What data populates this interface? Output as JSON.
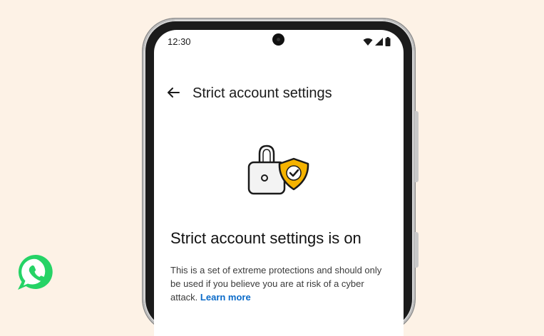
{
  "colors": {
    "background": "#fdf2e6",
    "link": "#0b6bc9",
    "shield": "#f5b300",
    "whatsapp": "#25d366"
  },
  "status_bar": {
    "time": "12:30",
    "icons": [
      "wifi-icon",
      "signal-icon",
      "battery-icon"
    ]
  },
  "app_bar": {
    "back_icon": "back-arrow-icon",
    "title": "Strict account settings"
  },
  "hero": {
    "icons": [
      "padlock-icon",
      "shield-check-icon"
    ]
  },
  "content": {
    "headline": "Strict account settings is on",
    "body": "This is a set of extreme protections and should only be used if you believe you are at risk of a cyber attack.",
    "link": "Learn more"
  },
  "brand": {
    "logo": "whatsapp-logo-icon"
  }
}
